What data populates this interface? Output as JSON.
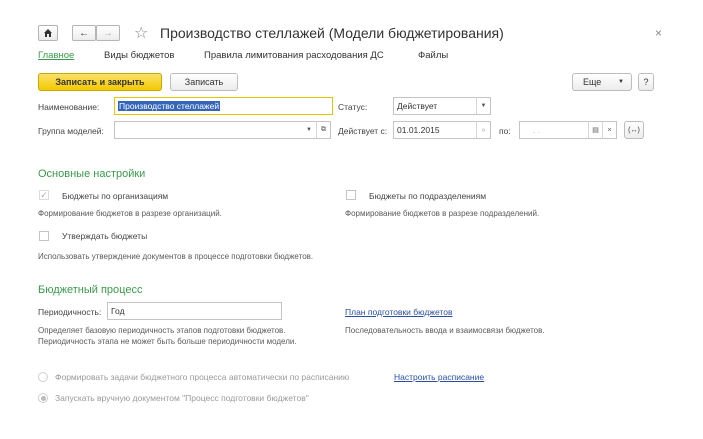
{
  "window": {
    "title": "Производство стеллажей (Модели бюджетирования)",
    "close_glyph": "×"
  },
  "tabs": [
    {
      "label": "Главное",
      "active": true
    },
    {
      "label": "Виды бюджетов",
      "active": false
    },
    {
      "label": "Правила лимитования расходования ДС",
      "active": false
    },
    {
      "label": "Файлы",
      "active": false
    }
  ],
  "toolbar": {
    "save_close_label": "Записать и закрыть",
    "save_label": "Записать",
    "more_label": "Еще",
    "help_label": "?"
  },
  "form": {
    "name_label": "Наименование:",
    "name_value": "Производство стеллажей",
    "status_label": "Статус:",
    "status_value": "Действует",
    "model_group_label": "Группа моделей:",
    "model_group_value": "",
    "valid_from_label": "Действует с:",
    "valid_from_value": "01.01.2015",
    "valid_to_label": "по:",
    "valid_to_placeholder": ".  .",
    "range_glyph": "(↔)"
  },
  "main_settings": {
    "title": "Основные настройки",
    "by_org_label": "Бюджеты по организациям",
    "by_org_checked": true,
    "by_org_hint": "Формирование бюджетов в разрезе организаций.",
    "by_dept_label": "Бюджеты по подразделениям",
    "by_dept_checked": false,
    "by_dept_hint": "Формирование бюджетов в разрезе подразделений.",
    "approve_label": "Утверждать бюджеты",
    "approve_checked": false,
    "approve_hint": "Использовать утверждение документов в процессе подготовки бюджетов."
  },
  "budget_process": {
    "title": "Бюджетный процесс",
    "periodicity_label": "Периодичность:",
    "periodicity_value": "Год",
    "plan_link": "План подготовки бюджетов",
    "periodicity_hint": "Определяет базовую периодичность этапов подготовки бюджетов. Периодичность этапа не может быть больше периодичности модели.",
    "plan_hint": "Последовательность ввода и взаимосвязи бюджетов.",
    "auto_tasks_label": "Формировать задачи бюджетного процесса автоматически по расписанию",
    "schedule_link": "Настроить расписание",
    "manual_label": "Запускать вручную документом \"Процесс подготовки бюджетов\"",
    "selected_mode": "manual"
  }
}
